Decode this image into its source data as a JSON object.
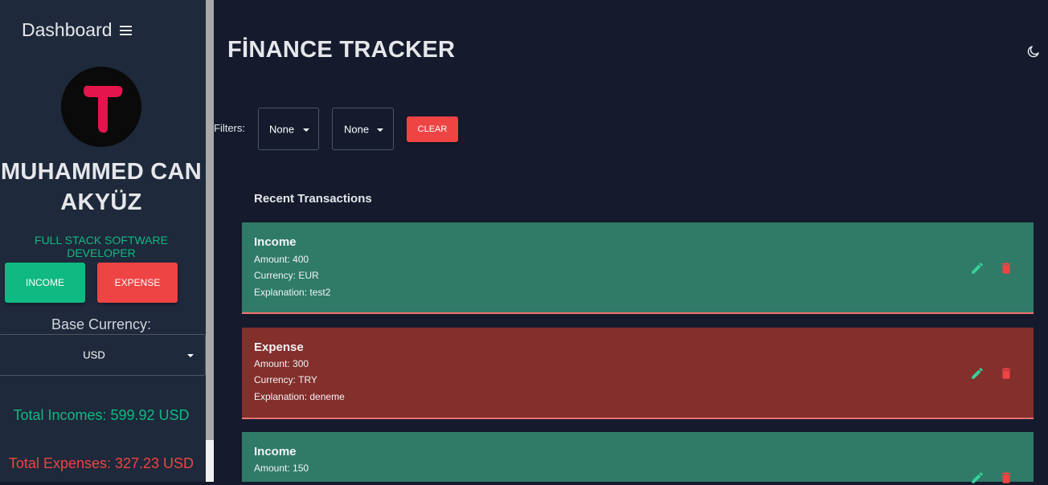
{
  "sidebar": {
    "dashboard_title": "Dashboard",
    "user_name": "MUHAMMED CAN AKYÜZ",
    "user_role": "FULL STACK SOFTWARE DEVELOPER",
    "income_button": "INCOME",
    "expense_button": "EXPENSE",
    "base_currency_label": "Base Currency:",
    "base_currency_value": "USD",
    "total_incomes": "Total Incomes: 599.92 USD",
    "total_expenses": "Total Expenses: 327.23 USD"
  },
  "header": {
    "title": "FİNANCE TRACKER"
  },
  "filters": {
    "label": "Filters:",
    "filter1_value": "None",
    "filter2_value": "None",
    "clear_button": "CLEAR"
  },
  "recent": {
    "title": "Recent Transactions",
    "transactions": [
      {
        "type": "Income",
        "amount": "Amount: 400",
        "currency": "Currency: EUR",
        "explanation": "Explanation: test2"
      },
      {
        "type": "Expense",
        "amount": "Amount: 300",
        "currency": "Currency: TRY",
        "explanation": "Explanation: deneme"
      },
      {
        "type": "Income",
        "amount": "Amount: 150",
        "currency": "",
        "explanation": ""
      }
    ]
  },
  "colors": {
    "income": "#10b981",
    "expense": "#ef4444",
    "income_card": "#2f7b67",
    "expense_card": "#832f2c",
    "background": "#151b2c",
    "sidebar": "#1e293b"
  },
  "icons": [
    "menu-icon",
    "moon-icon",
    "edit-icon",
    "delete-icon",
    "chevron-down-icon"
  ]
}
